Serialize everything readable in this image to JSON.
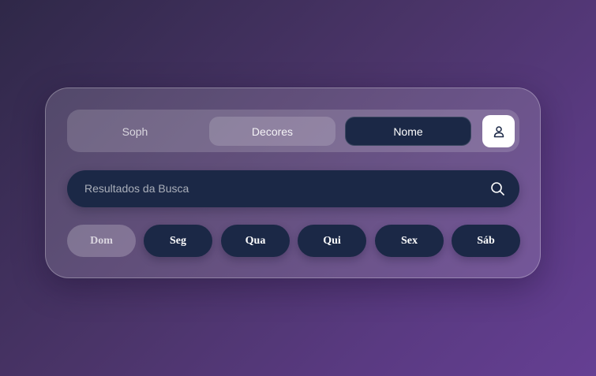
{
  "tabs": [
    {
      "label": "Soph"
    },
    {
      "label": "Decores"
    },
    {
      "label": "Nome"
    }
  ],
  "user_button": {
    "icon": "user-icon"
  },
  "search": {
    "label": "Resultados da Busca",
    "icon": "search-icon"
  },
  "days": [
    {
      "label": "Dom"
    },
    {
      "label": "Seg"
    },
    {
      "label": "Qua"
    },
    {
      "label": "Qui"
    },
    {
      "label": "Sex"
    },
    {
      "label": "Sáb"
    }
  ],
  "colors": {
    "active_dark": "#1b2846",
    "background_start": "#2f2848",
    "background_end": "#653f93"
  }
}
